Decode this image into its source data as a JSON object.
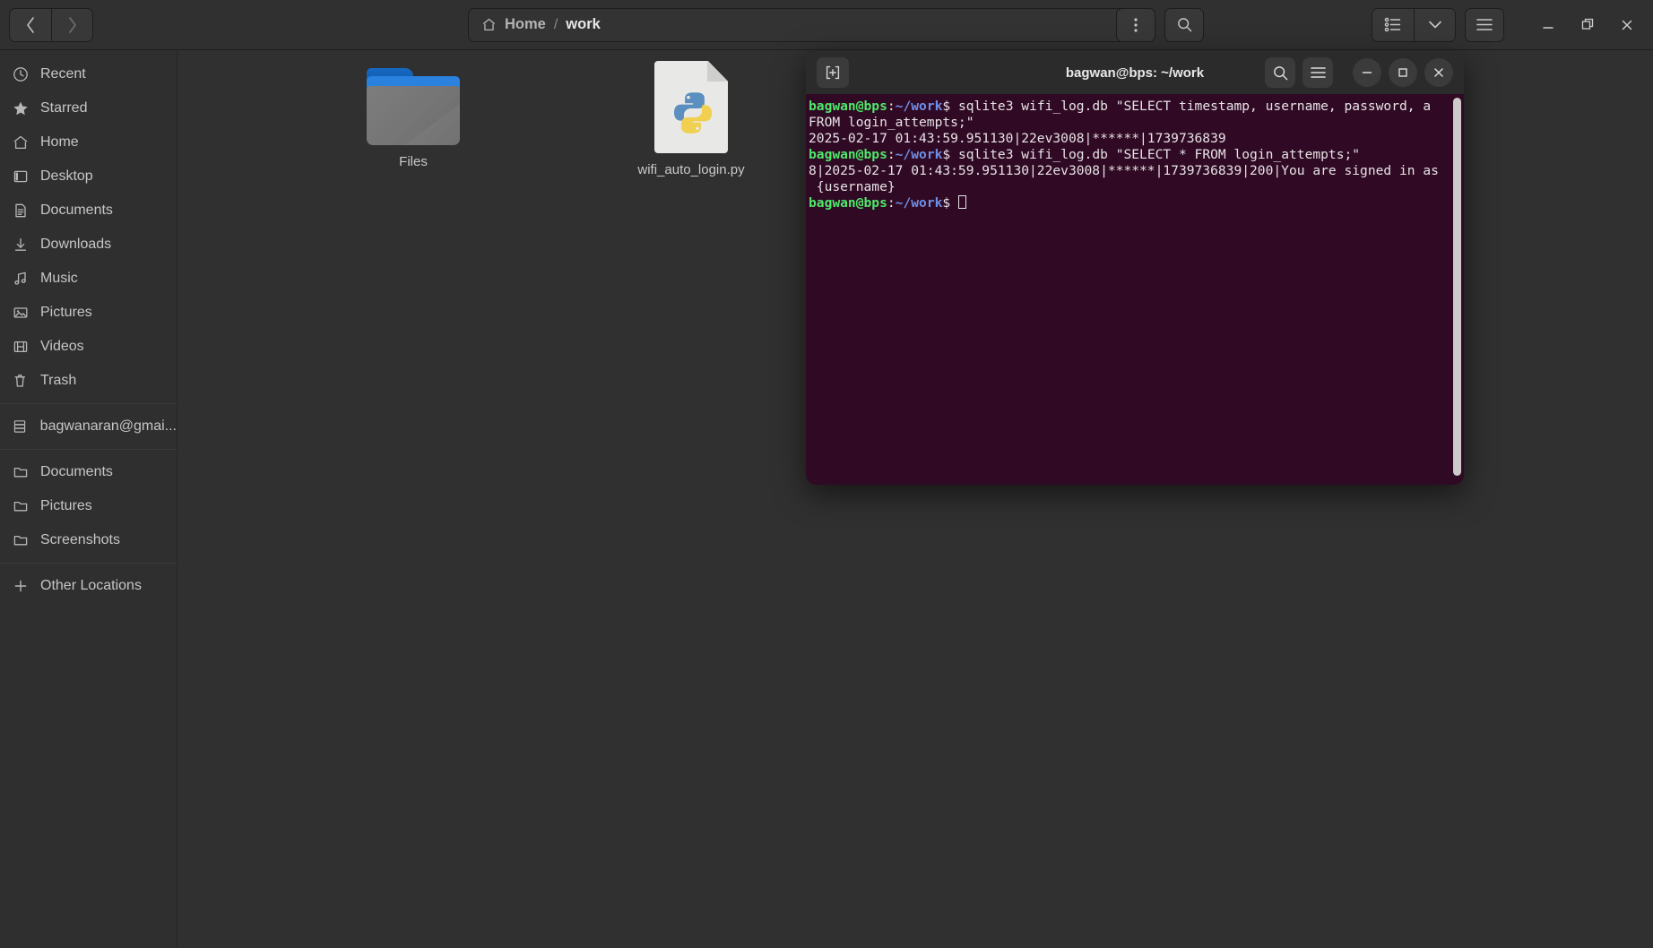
{
  "file_manager": {
    "nav": {
      "back_label": "‹",
      "forward_label": "›"
    },
    "pathbar": {
      "home_label": "Home",
      "separator": "/",
      "current_label": "work"
    },
    "header_buttons": {
      "menu_label": "⋮",
      "search_label": "search-icon",
      "view_list_label": "view-list-icon",
      "view_dropdown_label": "⌄",
      "main_menu_label": "hamburger-icon"
    },
    "window_controls": {
      "minimize": "–",
      "maximize": "❐",
      "close": "✕"
    },
    "sidebar": {
      "items": [
        {
          "label": "Recent",
          "icon": "clock-icon"
        },
        {
          "label": "Starred",
          "icon": "star-icon"
        },
        {
          "label": "Home",
          "icon": "home-icon"
        },
        {
          "label": "Desktop",
          "icon": "desktop-icon"
        },
        {
          "label": "Documents",
          "icon": "document-icon"
        },
        {
          "label": "Downloads",
          "icon": "download-icon"
        },
        {
          "label": "Music",
          "icon": "music-note-icon"
        },
        {
          "label": "Pictures",
          "icon": "image-icon"
        },
        {
          "label": "Videos",
          "icon": "film-icon"
        },
        {
          "label": "Trash",
          "icon": "trash-icon"
        }
      ],
      "account": {
        "label": "bagwanaran@gmai...",
        "icon": "server-icon"
      },
      "bookmarks": [
        {
          "label": "Documents",
          "icon": "folder-icon"
        },
        {
          "label": "Pictures",
          "icon": "folder-icon"
        },
        {
          "label": "Screenshots",
          "icon": "folder-icon"
        }
      ],
      "other_locations": {
        "label": "Other Locations",
        "icon": "plus-icon"
      }
    },
    "files": [
      {
        "name": "Files",
        "type": "folder"
      },
      {
        "name": "wifi_auto_login.py",
        "type": "python-file"
      }
    ]
  },
  "terminal": {
    "title": "bagwan@bps: ~/work",
    "new_tab_label": "new-tab-icon",
    "buttons": {
      "search": "search-icon",
      "menu": "hamburger-icon"
    },
    "window_controls": {
      "minimize": "–",
      "maximize": "□",
      "close": "✕"
    },
    "prompt": {
      "user_host": "bagwan@bps",
      "colon": ":",
      "path": "~/work",
      "dollar": "$"
    },
    "lines": [
      {
        "type": "prompt",
        "command": " sqlite3 wifi_log.db \"SELECT timestamp, username, password, a"
      },
      {
        "type": "output",
        "text": "FROM login_attempts;\""
      },
      {
        "type": "output",
        "text": "2025-02-17 01:43:59.951130|22ev3008|******|1739736839"
      },
      {
        "type": "prompt",
        "command": " sqlite3 wifi_log.db \"SELECT * FROM login_attempts;\""
      },
      {
        "type": "output",
        "text": "8|2025-02-17 01:43:59.951130|22ev3008|******|1739736839|200|You are signed in as"
      },
      {
        "type": "output",
        "text": " {username}"
      },
      {
        "type": "prompt",
        "command": " ",
        "cursor": true
      }
    ]
  },
  "colors": {
    "terminal_bg": "#300a24",
    "window_bg": "#303030",
    "sidebar_bg": "#2f2f2f",
    "prompt_green": "#4ee86a",
    "prompt_blue": "#6d8fe8",
    "folder_blue": "#2a81de"
  }
}
